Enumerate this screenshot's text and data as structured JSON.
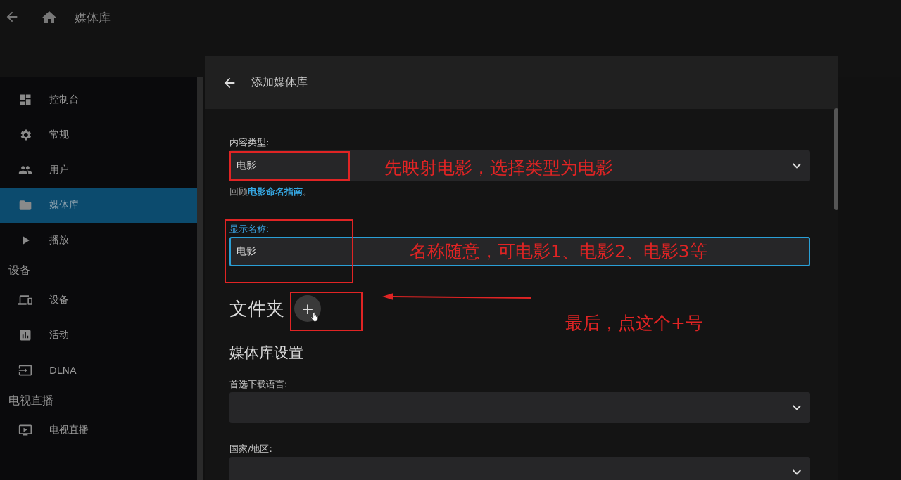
{
  "header": {
    "title": "媒体库"
  },
  "sidebar": {
    "sections": [
      {
        "items": [
          {
            "label": "控制台",
            "selected": false
          },
          {
            "label": "常规",
            "selected": false
          },
          {
            "label": "用户",
            "selected": false
          },
          {
            "label": "媒体库",
            "selected": true
          },
          {
            "label": "播放",
            "selected": false
          }
        ]
      },
      {
        "title": "设备",
        "items": [
          {
            "label": "设备",
            "selected": false
          },
          {
            "label": "活动",
            "selected": false
          },
          {
            "label": "DLNA",
            "selected": false
          }
        ]
      },
      {
        "title": "电视直播",
        "items": [
          {
            "label": "电视直播",
            "selected": false
          }
        ]
      }
    ]
  },
  "dialog": {
    "title": "添加媒体库",
    "content_type": {
      "label": "内容类型:",
      "value": "电影",
      "hint_prefix": "回顾",
      "hint_link": "电影命名指南",
      "hint_suffix": "。",
      "annotation": "先映射电影，选择类型为电影"
    },
    "display_name": {
      "label": "显示名称:",
      "value": "电影",
      "focused": true,
      "annotation": "名称随意，可电影1、电影2、电影3等"
    },
    "folders": {
      "title": "文件夹",
      "add_button": "+",
      "annotation": "最后，点这个+号"
    },
    "settings": {
      "title": "媒体库设置",
      "fields": [
        {
          "label": "首选下载语言:"
        },
        {
          "label": "国家/地区:"
        }
      ]
    }
  }
}
